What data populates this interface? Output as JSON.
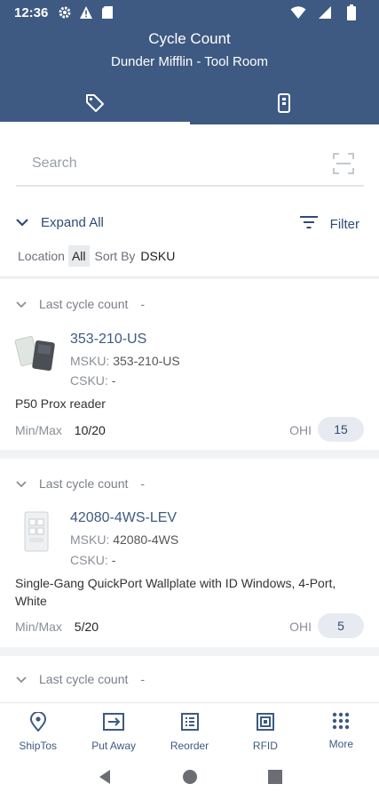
{
  "status_bar": {
    "time": "12:36"
  },
  "header": {
    "title": "Cycle Count",
    "subtitle": "Dunder Mifflin - Tool Room"
  },
  "tabs": [
    {
      "icon": "tag-icon",
      "active": true
    },
    {
      "icon": "device-icon",
      "active": false
    }
  ],
  "search": {
    "placeholder": "Search"
  },
  "controls": {
    "expand_label": "Expand All",
    "filter_label": "Filter",
    "location_label": "Location",
    "location_value": "All",
    "sort_label": "Sort By",
    "sort_value": "DSKU"
  },
  "items": [
    {
      "last_count_label": "Last cycle count",
      "last_count_value": "-",
      "sku": "353-210-US",
      "msku_label": "MSKU:",
      "msku": "353-210-US",
      "csku_label": "CSKU:",
      "csku": "-",
      "description": "P50 Prox reader",
      "minmax_label": "Min/Max",
      "minmax": "10/20",
      "ohi_label": "OHI",
      "ohi": "15"
    },
    {
      "last_count_label": "Last cycle count",
      "last_count_value": "-",
      "sku": "42080-4WS-LEV",
      "msku_label": "MSKU:",
      "msku": "42080-4WS",
      "csku_label": "CSKU:",
      "csku": "-",
      "description": "Single-Gang QuickPort Wallplate with ID Windows, 4-Port, White",
      "minmax_label": "Min/Max",
      "minmax": "5/20",
      "ohi_label": "OHI",
      "ohi": "5"
    },
    {
      "last_count_label": "Last cycle count",
      "last_count_value": "-"
    }
  ],
  "bottom_nav": [
    {
      "label": "ShipTos",
      "icon": "location-pin-icon"
    },
    {
      "label": "Put Away",
      "icon": "put-away-icon"
    },
    {
      "label": "Reorder",
      "icon": "reorder-list-icon"
    },
    {
      "label": "RFID",
      "icon": "rfid-icon"
    },
    {
      "label": "More",
      "icon": "grid-icon"
    }
  ],
  "colors": {
    "primary": "#3e5a82",
    "background": "#f2f3f5",
    "pill": "#e7ebf1"
  }
}
